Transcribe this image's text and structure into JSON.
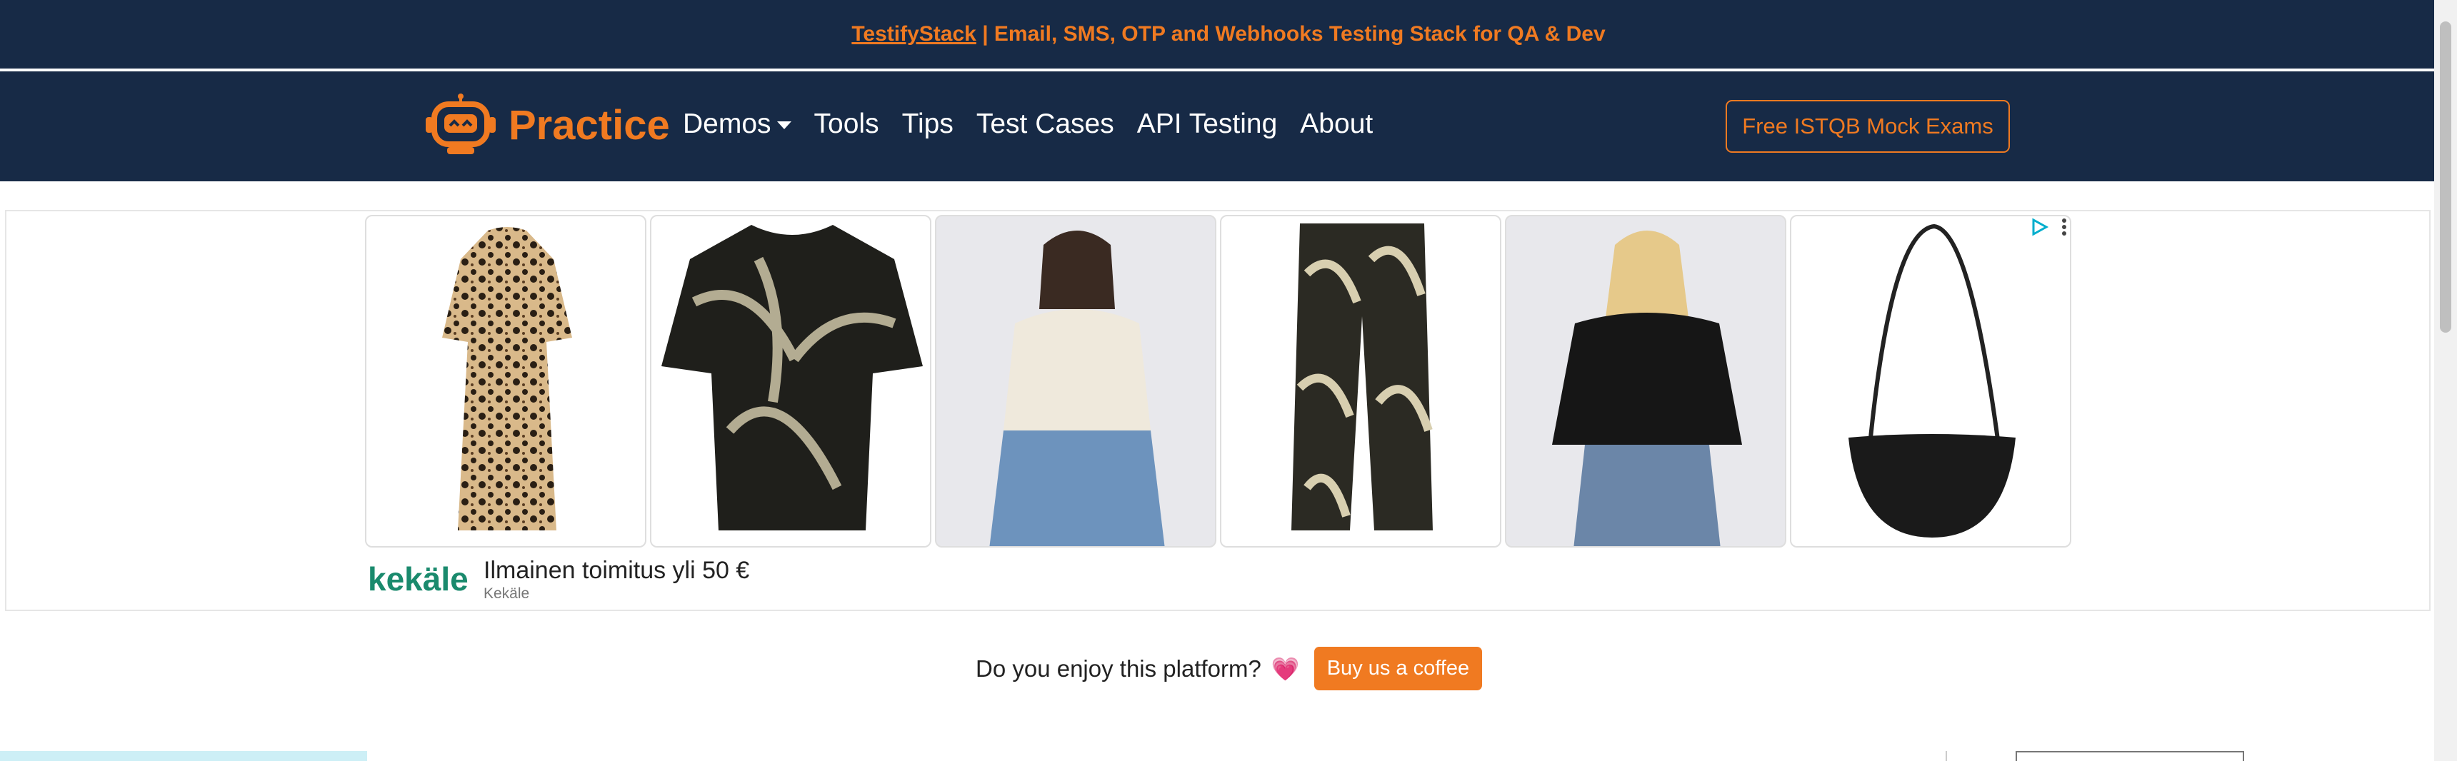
{
  "topbar": {
    "brand_link": "TestifyStack",
    "tagline": " | Email, SMS, OTP and Webhooks Testing Stack for QA & Dev"
  },
  "navbar": {
    "brand": "Practice",
    "items": [
      {
        "label": "Demos",
        "dropdown": true
      },
      {
        "label": "Tools"
      },
      {
        "label": "Tips"
      },
      {
        "label": "Test Cases"
      },
      {
        "label": "API Testing"
      },
      {
        "label": "About"
      }
    ],
    "cta": "Free ISTQB Mock Exams"
  },
  "ad": {
    "logo": "kekäle",
    "headline": "Ilmainen toimitus yli 50 €",
    "advertiser": "Kekäle",
    "products": [
      "leopard-dress",
      "palm-print-top",
      "cream-knit-sweater",
      "palm-print-trousers",
      "black-sweater",
      "black-crossbody-bag"
    ]
  },
  "support": {
    "question": "Do you enjoy this platform?",
    "heart": "💗",
    "button": "Buy us a coffee"
  },
  "colors": {
    "navy": "#172a46",
    "orange": "#f07a21",
    "kekale_green": "#1a8a6d"
  }
}
